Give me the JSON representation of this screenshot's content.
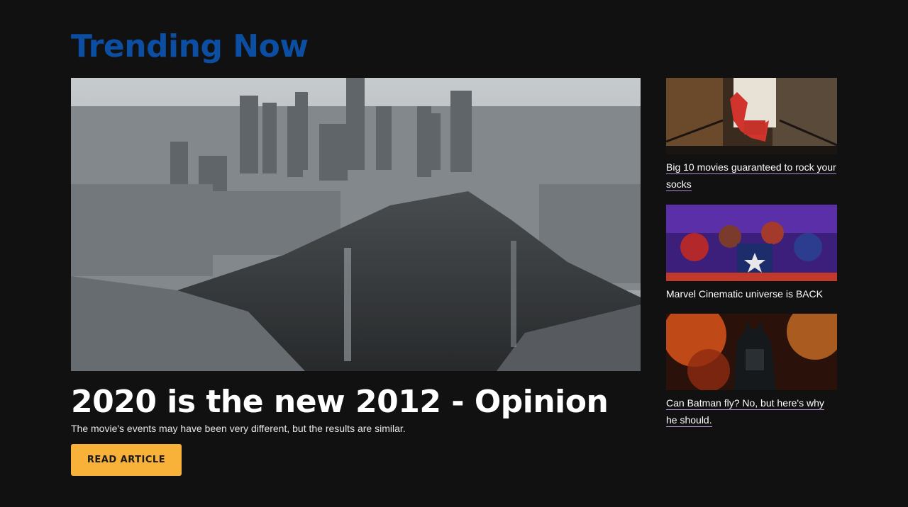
{
  "section": {
    "title": "Trending Now"
  },
  "featured": {
    "image_alt": "City skyline split by a massive earthquake chasm",
    "title": "2020 is the new 2012 - Opinion",
    "subtitle": "The movie's events may have been very different, but the results are similar.",
    "button_label": "READ ARTICLE",
    "button_color": "#f8b23a"
  },
  "sidebar": {
    "items": [
      {
        "label": "Big 10 movies guaranteed to rock your socks",
        "image_icon": "joker-stairs-image"
      },
      {
        "label": "Marvel Cinematic universe is BACK",
        "image_icon": "avengers-poster-image"
      },
      {
        "label": "Can Batman fly? No, but here's why he should.",
        "image_icon": "batman-poster-image"
      }
    ]
  },
  "colors": {
    "background": "#111111",
    "title_blue": "#0b4ea2",
    "text": "#ffffff",
    "link_underline": "#b38bd1"
  }
}
